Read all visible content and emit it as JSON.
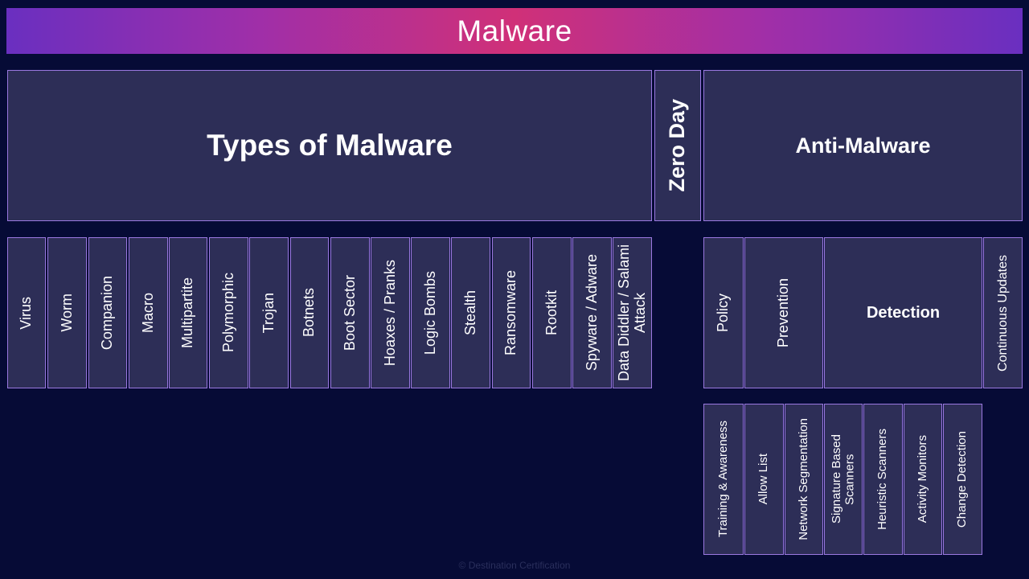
{
  "header": {
    "title": "Malware"
  },
  "sections": {
    "types": "Types of Malware",
    "zero_day": "Zero Day",
    "anti": "Anti-Malware"
  },
  "malware_types": [
    "Virus",
    "Worm",
    "Companion",
    "Macro",
    "Multipartite",
    "Polymorphic",
    "Trojan",
    "Botnets",
    "Boot Sector",
    "Hoaxes / Pranks",
    "Logic Bombs",
    "Stealth",
    "Ransomware",
    "Rootkit",
    "Spyware / Adware",
    "Data Diddler / Salami Attack"
  ],
  "anti_malware": {
    "policy": "Policy",
    "prevention": "Prevention",
    "detection": "Detection",
    "continuous_updates": "Continuous Updates",
    "sub_items": [
      "Training & Awareness",
      "Allow List",
      "Network Segmentation",
      "Signature Based Scanners",
      "Heuristic Scanners",
      "Activity Monitors",
      "Change Detection"
    ]
  },
  "footer": {
    "copyright": "© Destination Certification"
  },
  "colors": {
    "background": "#060b36",
    "box_fill": "#2d2e57",
    "box_border": "#9a78e0",
    "banner_start": "#6a2fc0",
    "banner_mid": "#d03078"
  }
}
